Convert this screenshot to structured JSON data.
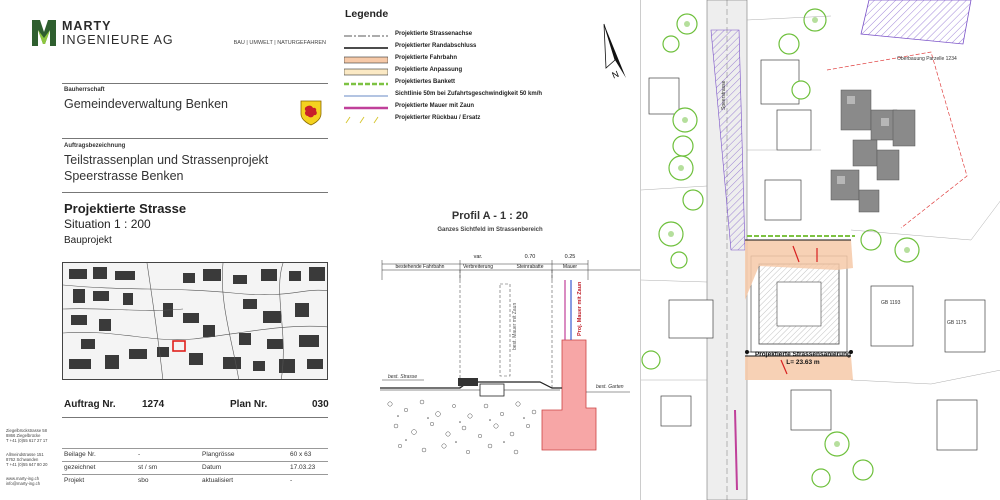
{
  "title_block": {
    "company_line1": "MARTY",
    "company_line2": "INGENIEURE AG",
    "tagline": "BAU | UMWELT | NATURGEFAHREN",
    "client_label": "Bauherrschaft",
    "client_name": "Gemeindeverwaltung Benken",
    "job_label": "Auftragsbezeichnung",
    "job_line1": "Teilstrassenplan und Strassenprojekt",
    "job_line2": "Speerstrasse Benken",
    "project_title": "Projektierte Strasse",
    "scale_line": "Situation   1 : 200",
    "phase": "Bauprojekt",
    "order_label": "Auftrag Nr.",
    "order_number": "1274",
    "plan_label": "Plan Nr.",
    "plan_number": "030",
    "address1": [
      "Ziegelbrückstrasse 58",
      "8866 Ziegelbrücke",
      "T +41 (0)55 617 27 17"
    ],
    "address2": [
      "Allmeindstrasse 151",
      "8762 Schwanden",
      "T +41 (0)55 647 80 20"
    ],
    "address3": [
      "www.marty-ing.ch",
      "info@marty-ing.ch"
    ],
    "meta": [
      {
        "label": "Beilage Nr.",
        "value": "-",
        "label2": "Plangrösse",
        "value2": "60 x 63"
      },
      {
        "label": "gezeichnet",
        "value": "st / sm",
        "label2": "Datum",
        "value2": "17.03.23"
      },
      {
        "label": "Projekt",
        "value": "sbo",
        "label2": "aktualisiert",
        "value2": "-"
      }
    ]
  },
  "legend": {
    "title": "Legende",
    "items": [
      {
        "label": "Projektierte Strassenachse",
        "symbol": "axis"
      },
      {
        "label": "Projektierter Randabschluss",
        "symbol": "curb"
      },
      {
        "label": "Projektierte Fahrbahn",
        "symbol": "roadway"
      },
      {
        "label": "Projektierte Anpassung",
        "symbol": "adjustment"
      },
      {
        "label": "Projektiertes Bankett",
        "symbol": "bankett"
      },
      {
        "label": "Sichtlinie 50m bei Zufahrtsgeschwindigkeit 50 km/h",
        "symbol": "sightline"
      },
      {
        "label": "Projektierte Mauer mit Zaun",
        "symbol": "wall"
      },
      {
        "label": "Projektierter Rückbau / Ersatz",
        "symbol": "removal"
      }
    ]
  },
  "profile": {
    "title": "Profil A - 1 : 20",
    "subtitle": "Ganzes Sichtfeld im Strassenbereich",
    "dim_values": [
      "var.",
      "0.70",
      "0.25"
    ],
    "zones": [
      "bestehende Fahrbahn",
      "Verbreiterung",
      "Steinrabatte",
      "Mauer"
    ],
    "label_wall_existing": "best. Mauer mit Zaun",
    "label_wall_new": "Proj. Mauer mit Zaun",
    "label_road": "best. Strasse",
    "label_garden": "best. Garten"
  },
  "site_plan": {
    "renovation_line1": "Projektierte Strassensanierung",
    "renovation_line2": "L= 23.63 m",
    "labels": [
      "Speerstrasse",
      "Oberbauung Parzelle 1234",
      "GB 1193",
      "GB 1175"
    ]
  },
  "colors": {
    "roadway": "#f6c9a8",
    "wall": "#c0409a",
    "bankett": "#7dc242",
    "profile_wall": "#f7a6a6",
    "tree": "#6ec03c",
    "building": "#8a8a8a",
    "hatch": "#7a52c8"
  }
}
